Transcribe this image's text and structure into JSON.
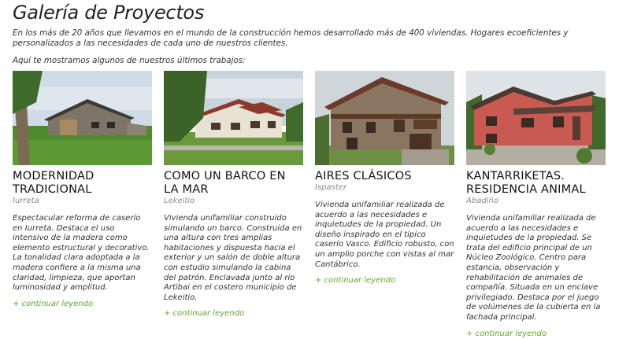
{
  "page": {
    "title": "Galería de Proyectos",
    "intro": "En los más de 20 años que llevamos en el mundo de la construcción hemos desarrollado más de 400 viviendas. Hogares ecoeficientes y personalizados a las necesidades de cada uno de nuestros clientes.",
    "subintro": "Aquí te mostramos algunos de nuestros últimos trabajos:"
  },
  "projects": [
    {
      "title": "MODERNIDAD TRADICIONAL",
      "location": "Iurreta",
      "description": "Espectacular reforma de caserío en Iurreta. Destaca el uso intensivo de la madera como elemento estructural y decorativo. La tonalidad clara adoptada a la madera confiere a la misma una claridad, limpieza, que aportan luminosidad y amplitud.",
      "link": "+ continuar leyendo"
    },
    {
      "title": "COMO UN BARCO EN LA MAR",
      "location": "Lekeitio",
      "description": "Vivienda unifamiliar construido simulando un barco. Construida en una altura con tres amplias habitaciones y dispuesta hacia el exterior y un salón de doble altura con estudio simulando la cabina del patrón. Enclavada junto al río Artibai en el costero municipio de Lekeitio.",
      "link": "+ continuar leyendo"
    },
    {
      "title": "AIRES CLÁSICOS",
      "location": "Ispaster",
      "description": "Vivienda unifamiliar realizada de acuerdo a las necesidades e inquietudes de la propiedad. Un diseño inspirado en el típico caserío Vasco. Edificio robusto, con un amplio porche con vistas al mar Cantábrico.",
      "link": "+ continuar leyendo"
    },
    {
      "title": "KANTARRIKETAS. RESIDENCIA ANIMAL",
      "location": "Abadiño",
      "description": "Vivienda unifamiliar realizada de acuerdo a las necesidades e inquietudes de la propiedad. Se trata del edificio principal de un Núcleo Zoológico, Centro para estancia, observación y rehabilitación de animales de compañía. Situada en un enclave privilegiado. Destaca por el juego de volúmenes de la cubierta en la fachada principal.",
      "link": "+ continuar leyendo"
    }
  ]
}
